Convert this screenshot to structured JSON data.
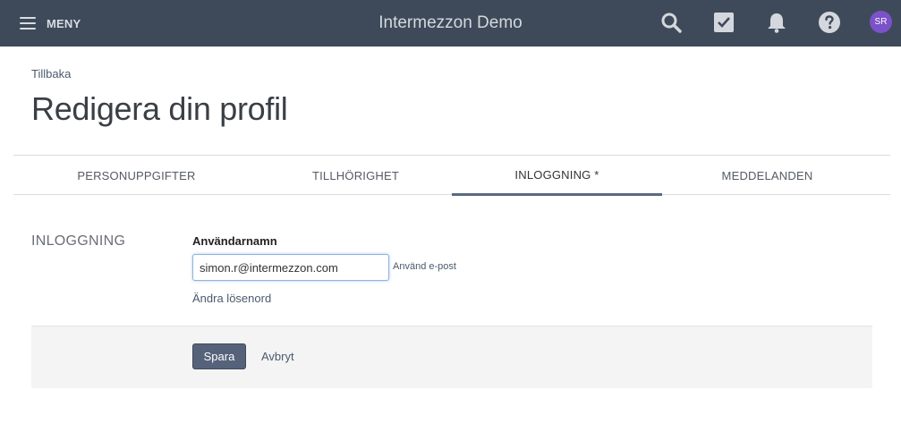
{
  "header": {
    "menu_label": "MENY",
    "app_title": "Intermezzon Demo",
    "icons": [
      "search-icon",
      "tasks-check-icon",
      "bell-icon",
      "help-icon"
    ],
    "avatar_initials": "SR",
    "colors": {
      "bar": "#3e4a5a",
      "avatar": "#7b52c9"
    }
  },
  "back_link": "Tillbaka",
  "page_title": "Redigera din profil",
  "tabs": [
    {
      "label": "PERSONUPPGIFTER",
      "active": false
    },
    {
      "label": "TILLHÖRIGHET",
      "active": false
    },
    {
      "label": "INLOGGNING *",
      "active": true
    },
    {
      "label": "MEDDELANDEN",
      "active": false
    }
  ],
  "login_section": {
    "title": "INLOGGNING",
    "username_label": "Användarnamn",
    "username_value": "simon.r@intermezzon.com",
    "use_email_link": "Använd e-post",
    "change_password_link": "Ändra lösenord"
  },
  "actions": {
    "save_label": "Spara",
    "cancel_label": "Avbryt"
  }
}
